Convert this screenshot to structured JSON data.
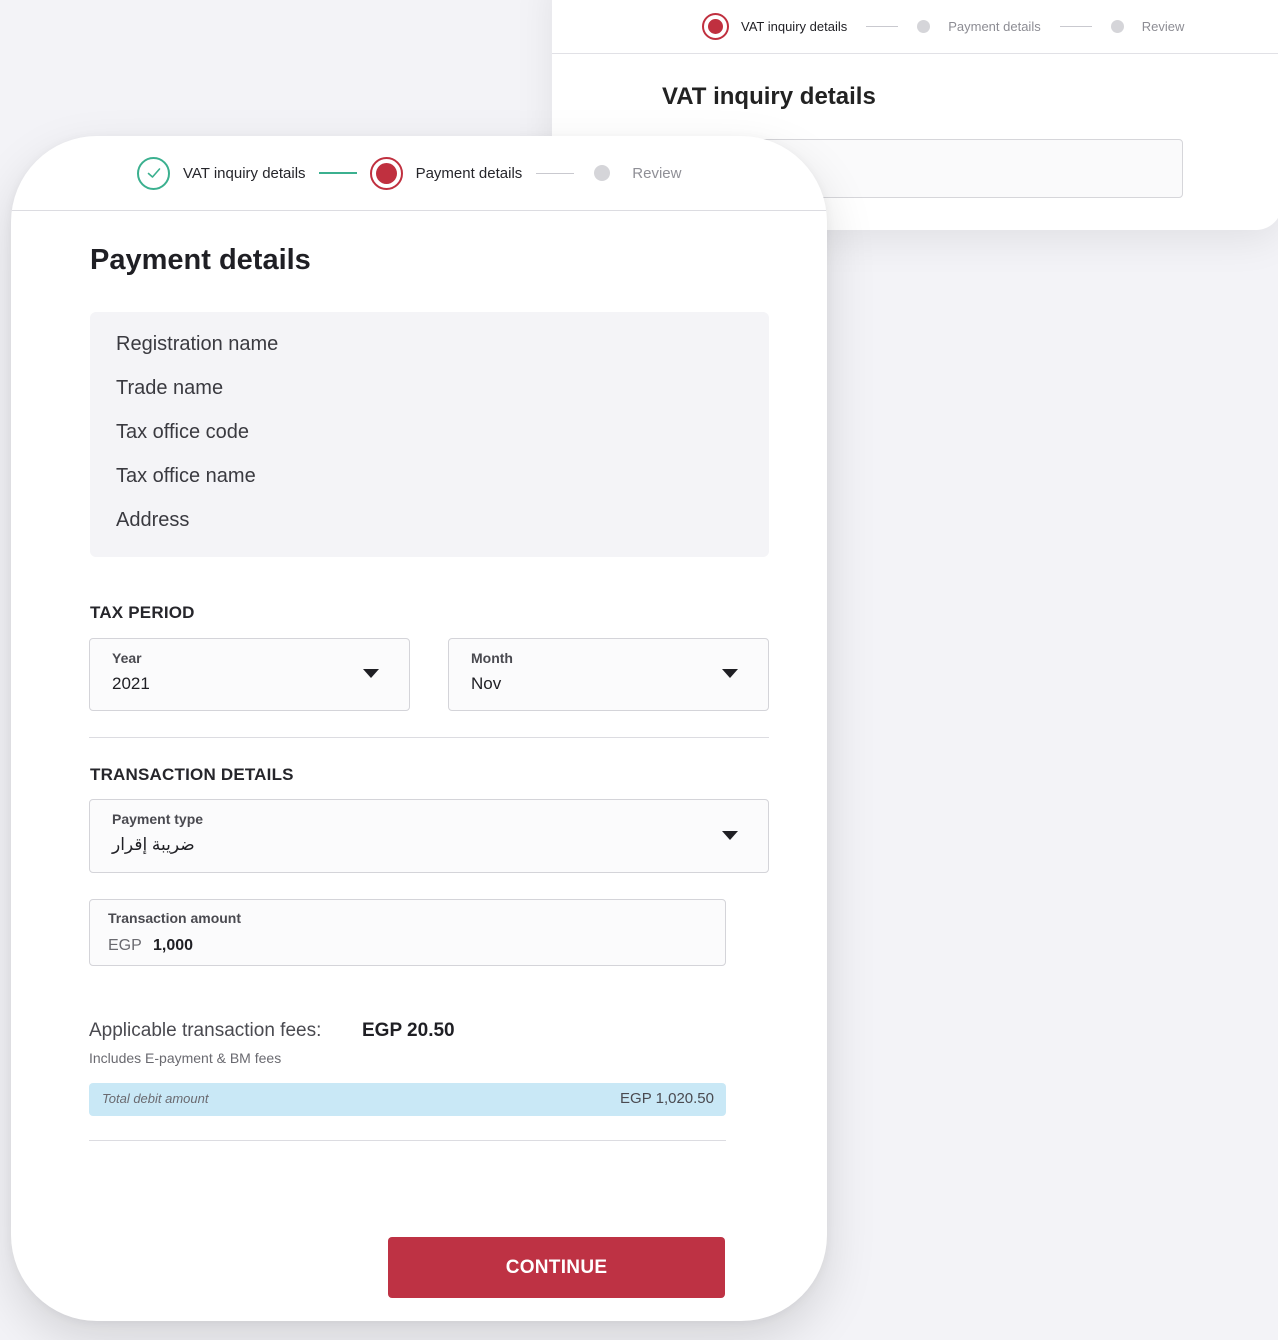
{
  "background_card": {
    "stepper": [
      "VAT inquiry details",
      "Payment details",
      "Review"
    ],
    "title": "VAT inquiry details"
  },
  "stepper": {
    "steps": [
      {
        "label": "VAT inquiry details",
        "state": "completed"
      },
      {
        "label": "Payment details",
        "state": "active"
      },
      {
        "label": "Review",
        "state": "pending"
      }
    ]
  },
  "page": {
    "title": "Payment details"
  },
  "info": {
    "rows": [
      "Registration name",
      "Trade name",
      "Tax office code",
      "Tax office name",
      "Address"
    ]
  },
  "tax_period": {
    "title": "TAX PERIOD",
    "year": {
      "label": "Year",
      "value": "2021"
    },
    "month": {
      "label": "Month",
      "value": "Nov"
    }
  },
  "transaction": {
    "title": "TRANSACTION DETAILS",
    "payment_type": {
      "label": "Payment type",
      "value": "ضريبة إقرار"
    },
    "amount": {
      "label": "Transaction amount",
      "currency": "EGP",
      "value": "1,000"
    }
  },
  "fees": {
    "label": "Applicable transaction fees:",
    "value": "EGP 20.50",
    "note": "Includes E-payment & BM fees"
  },
  "total": {
    "label": "Total debit amount",
    "value": "EGP 1,020.50"
  },
  "actions": {
    "continue_label": "CONTINUE"
  },
  "colors": {
    "accent": "#be3244",
    "success": "#3bb08f",
    "total_bg": "#c9e8f6"
  }
}
